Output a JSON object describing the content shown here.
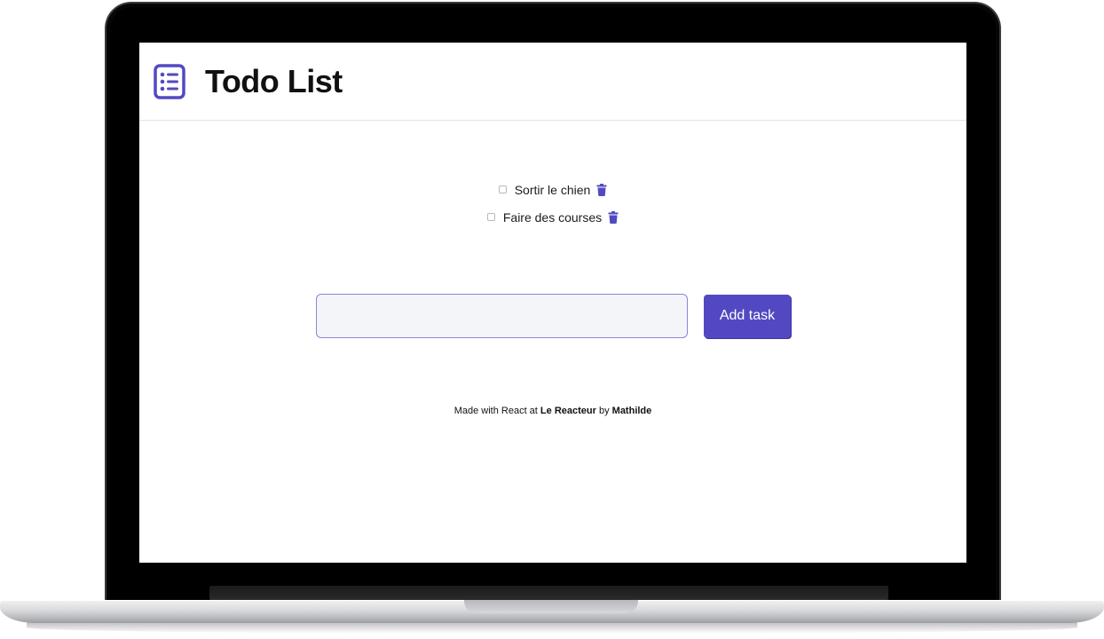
{
  "app": {
    "title": "Todo List",
    "accent_color": "#5249c2",
    "logo_icon": "list-icon"
  },
  "tasks": [
    {
      "label": "Sortir le chien",
      "done": false,
      "delete_icon": "trash-icon"
    },
    {
      "label": "Faire des courses",
      "done": false,
      "delete_icon": "trash-icon"
    }
  ],
  "form": {
    "input_value": "",
    "input_placeholder": "",
    "submit_label": "Add task"
  },
  "footer": {
    "prefix": "Made with React at",
    "school": "Le Reacteur",
    "joiner": "by",
    "author": "Mathilde"
  }
}
